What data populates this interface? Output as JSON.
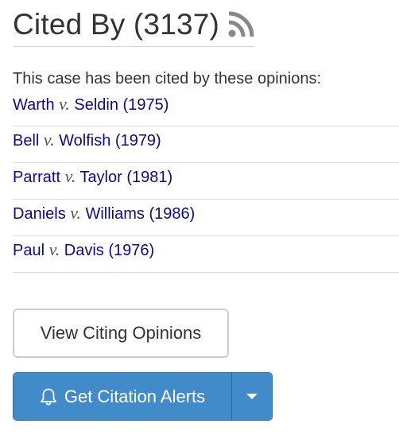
{
  "header": {
    "title": "Cited By (3137)",
    "rss_icon": "rss-feed-icon"
  },
  "intro": "This case has been cited by these opinions:",
  "versus": "v.",
  "citations": [
    {
      "party1": "Warth",
      "party2": "Seldin",
      "year": "(1975)"
    },
    {
      "party1": "Bell",
      "party2": "Wolfish",
      "year": "(1979)"
    },
    {
      "party1": "Parratt",
      "party2": "Taylor",
      "year": "(1981)"
    },
    {
      "party1": "Daniels",
      "party2": "Williams",
      "year": "(1986)"
    },
    {
      "party1": "Paul",
      "party2": "Davis",
      "year": "(1976)"
    }
  ],
  "buttons": {
    "view_citing": "View Citing Opinions",
    "get_alerts": "Get Citation Alerts",
    "alerts_icon": "bell-icon",
    "dropdown_icon": "caret-down-icon"
  },
  "colors": {
    "link": "#0b0a8f",
    "primary_button": "#428bca",
    "rss_icon": "#888888"
  }
}
